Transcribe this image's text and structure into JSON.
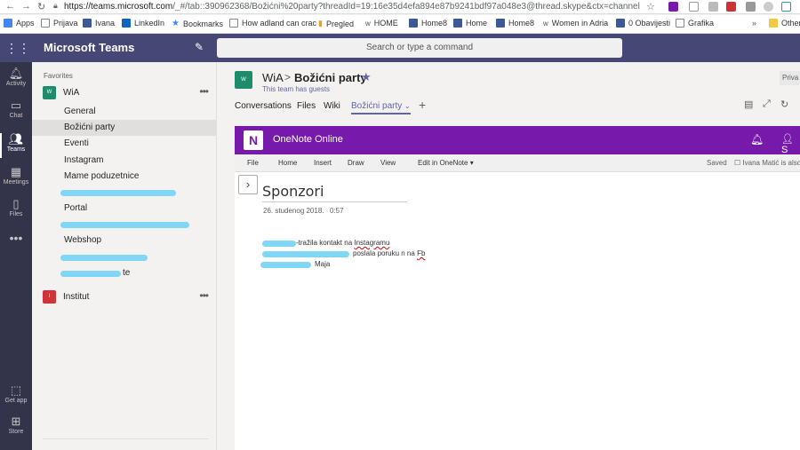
{
  "browser": {
    "url_host": "https://teams.microsoft.com",
    "url_rest": "/_#/tab::390962368/Božićni%20party?threadId=19:16e35d4efa894e87b9241bdf97a048e3@thread.skype&ctx=channel",
    "bookmarks": [
      "Apps",
      "Prijava",
      "Ivana",
      "LinkedIn",
      "Bookmarks",
      "How adland can crac",
      "Pregled",
      "HOME",
      "Home8",
      "Home",
      "Home8",
      "Women in Adria",
      "0 Obavijesti",
      "Grafika",
      "Other"
    ]
  },
  "header": {
    "app_title": "Microsoft Teams",
    "search_placeholder": "Search or type a command"
  },
  "appbar": {
    "items": [
      "Activity",
      "Chat",
      "Teams",
      "Meetings",
      "Files",
      "Get app",
      "Store"
    ]
  },
  "teamlist": {
    "favorites_label": "Favorites",
    "teams": [
      {
        "avatar": "W",
        "name": "WiA",
        "more": "•••",
        "channels": [
          "General",
          "Božićni party",
          "Eventi",
          "Instagram",
          "Mame poduzetnice",
          "",
          "Portal",
          "",
          "Webshop",
          "",
          "te"
        ]
      },
      {
        "avatar": "I",
        "name": "Institut",
        "more": "•••"
      }
    ]
  },
  "channel": {
    "avatar": "W",
    "team": "WiA",
    "separator": ">",
    "name": "Božićni party",
    "guests": "This team has guests",
    "private_badge": "Priva",
    "tabs": [
      "Conversations",
      "Files",
      "Wiki",
      "Božićni party"
    ],
    "add_tab": "+"
  },
  "onenote": {
    "title": "OneNote Online",
    "share": "S",
    "ribbon": [
      "File",
      "Home",
      "Insert",
      "Draw",
      "View",
      "Edit in OneNote"
    ],
    "saved": "Saved",
    "user": "Ivana Matić is also",
    "page": {
      "title": "Sponzori",
      "date": "26. studenog 2018.",
      "time": "0:57",
      "lines": [
        {
          "pre": "",
          "text": "-tražila kontakt na ",
          "link": "Instagramu"
        },
        {
          "pre": "",
          "text": "poslala poruku n na ",
          "link": "Fb"
        },
        {
          "pre": "",
          "text": "Maja",
          "link": ""
        }
      ]
    }
  },
  "colors": {
    "teams_header": "#464775",
    "appbar": "#33344a",
    "accent": "#6264a7",
    "onenote": "#7719aa",
    "redaction": "#7fd6f5"
  }
}
